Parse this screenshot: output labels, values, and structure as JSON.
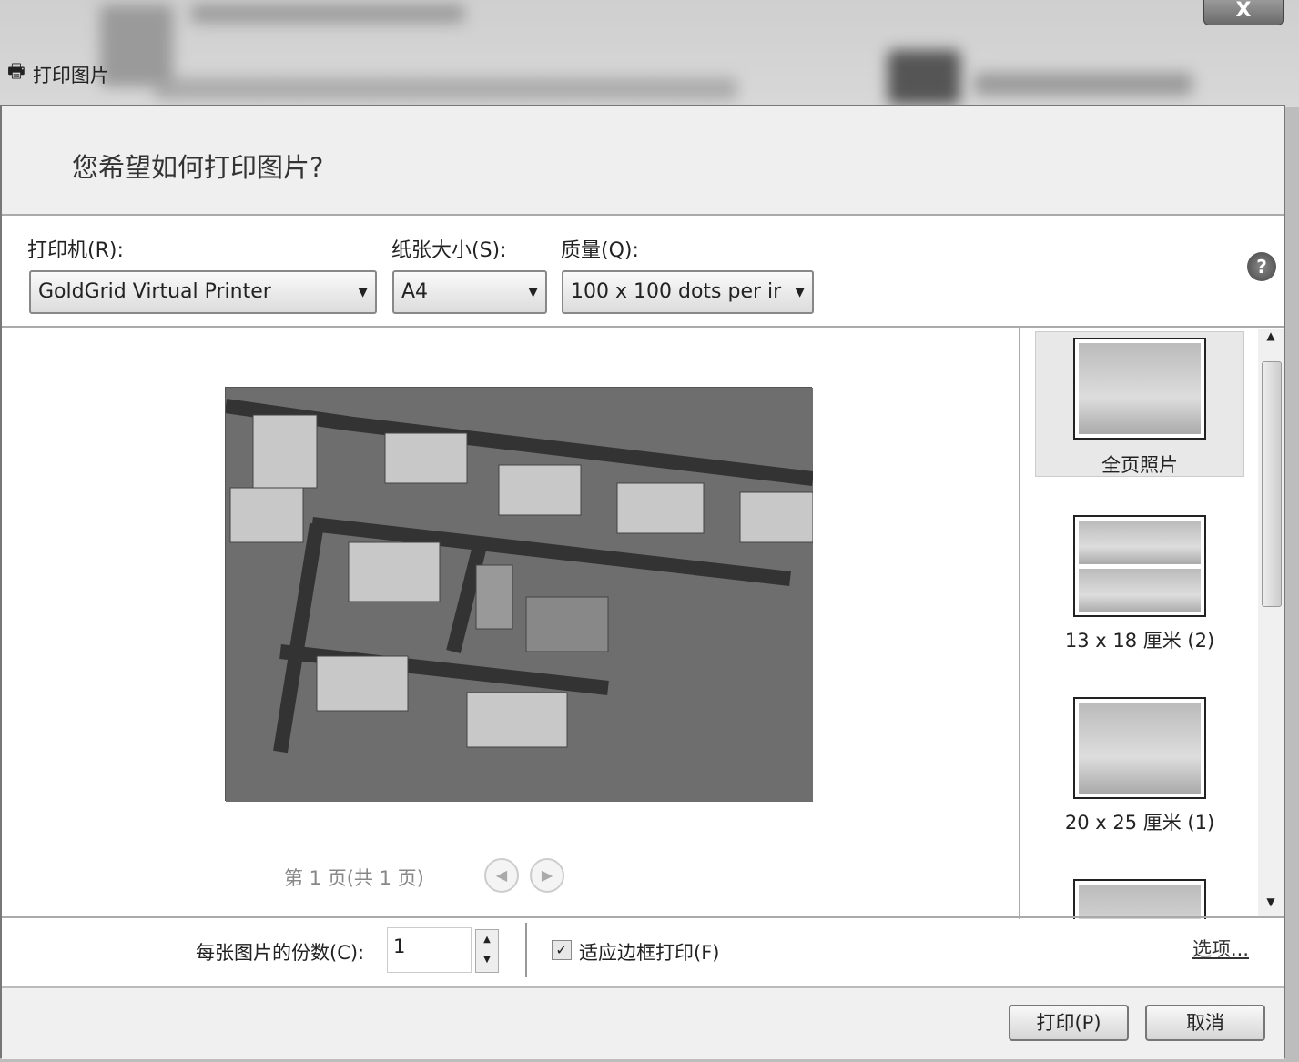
{
  "window": {
    "title": "打印图片",
    "close_label": "X"
  },
  "dialog": {
    "heading": "您希望如何打印图片?",
    "printer": {
      "label": "打印机(R):",
      "value": "GoldGrid Virtual Printer"
    },
    "paper": {
      "label": "纸张大小(S):",
      "value": "A4"
    },
    "quality": {
      "label": "质量(Q):",
      "value": "100 x 100 dots per ir"
    },
    "help": "?",
    "pager": "第 1 页(共 1 页)",
    "layouts": [
      {
        "label": "全页照片",
        "selected": true
      },
      {
        "label": "13 x 18 厘米 (2)"
      },
      {
        "label": "20 x 25 厘米 (1)"
      }
    ],
    "copies": {
      "label": "每张图片的份数(C):",
      "value": "1"
    },
    "fit": {
      "label": "适应边框打印(F)",
      "checked": true
    },
    "options_link": "选项...",
    "print_button": "打印(P)",
    "cancel_button": "取消"
  }
}
